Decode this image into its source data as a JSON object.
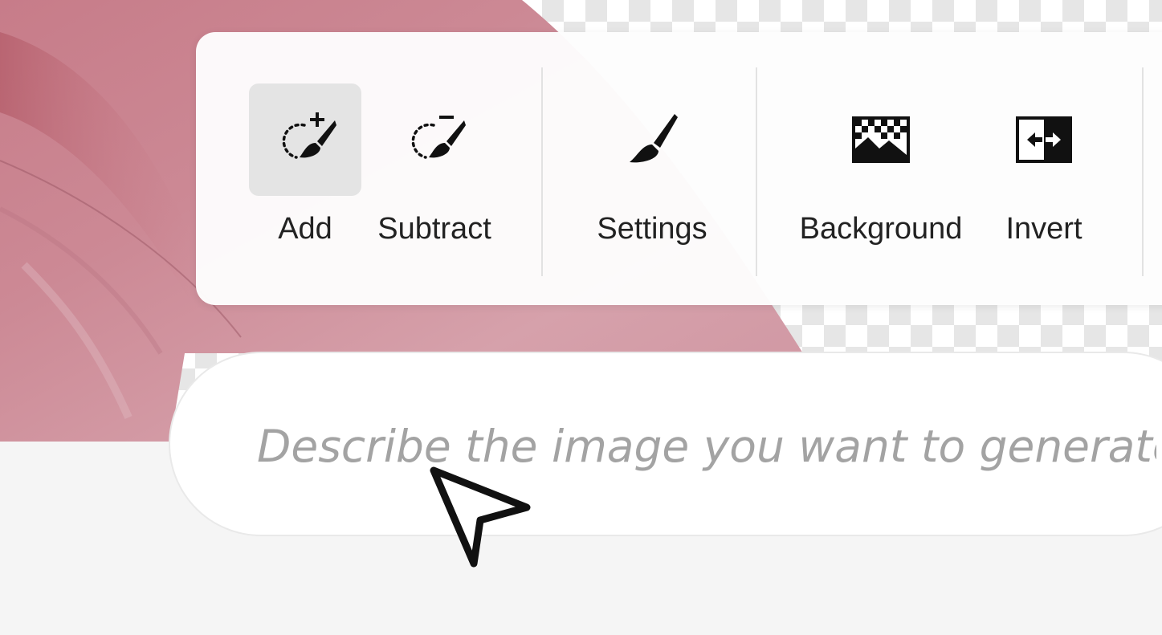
{
  "toolbar": {
    "add_label": "Add",
    "subtract_label": "Subtract",
    "settings_label": "Settings",
    "background_label": "Background",
    "invert_label": "Invert",
    "active_tool": "Add"
  },
  "prompt": {
    "placeholder": "Describe the image you want to generate"
  },
  "icons": {
    "add": "add-selection-brush-icon",
    "subtract": "subtract-selection-brush-icon",
    "settings": "brush-icon",
    "background": "background-image-icon",
    "invert": "invert-icon",
    "cursor": "mouse-pointer-icon"
  },
  "colors": {
    "active_tool_bg": "#e4e4e4",
    "canvas_pink": "#c98592",
    "placeholder_text": "#a3a3a3"
  }
}
